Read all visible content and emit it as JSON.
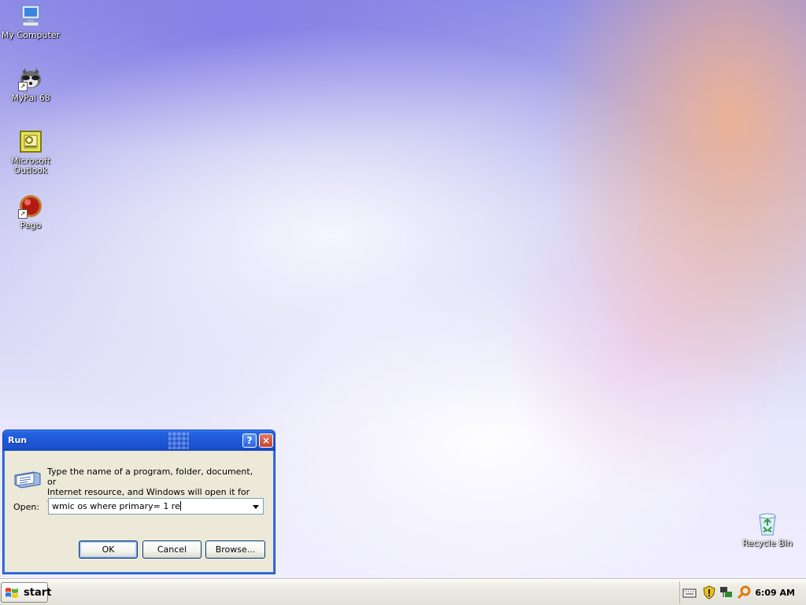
{
  "desktop": {
    "icons": [
      {
        "label": "My Computer"
      },
      {
        "label": "MyPal 68"
      },
      {
        "label_line1": "Microsoft",
        "label_line2": "Outlook"
      },
      {
        "label": "Pego"
      },
      {
        "label": "Recycle Bin"
      }
    ]
  },
  "run_dialog": {
    "title": "Run",
    "help_glyph": "?",
    "close_glyph": "×",
    "instructions_line1": "Type the name of a program, folder, document, or",
    "instructions_line2": "Internet resource, and Windows will open it for you.",
    "open_label": "Open:",
    "open_value": "wmic os where primary= 1 re",
    "ok_label": "OK",
    "cancel_label": "Cancel",
    "browse_label": "Browse..."
  },
  "taskbar": {
    "start_label": "start",
    "clock": "6:09 AM",
    "tray_icons": [
      "keyboard-icon",
      "security-shield-icon",
      "network-icon",
      "search-icon"
    ]
  },
  "colors": {
    "titlebar_blue": "#1f57d6",
    "dialog_bg": "#ece9d8",
    "taskbar_bg": "#eeede5"
  }
}
